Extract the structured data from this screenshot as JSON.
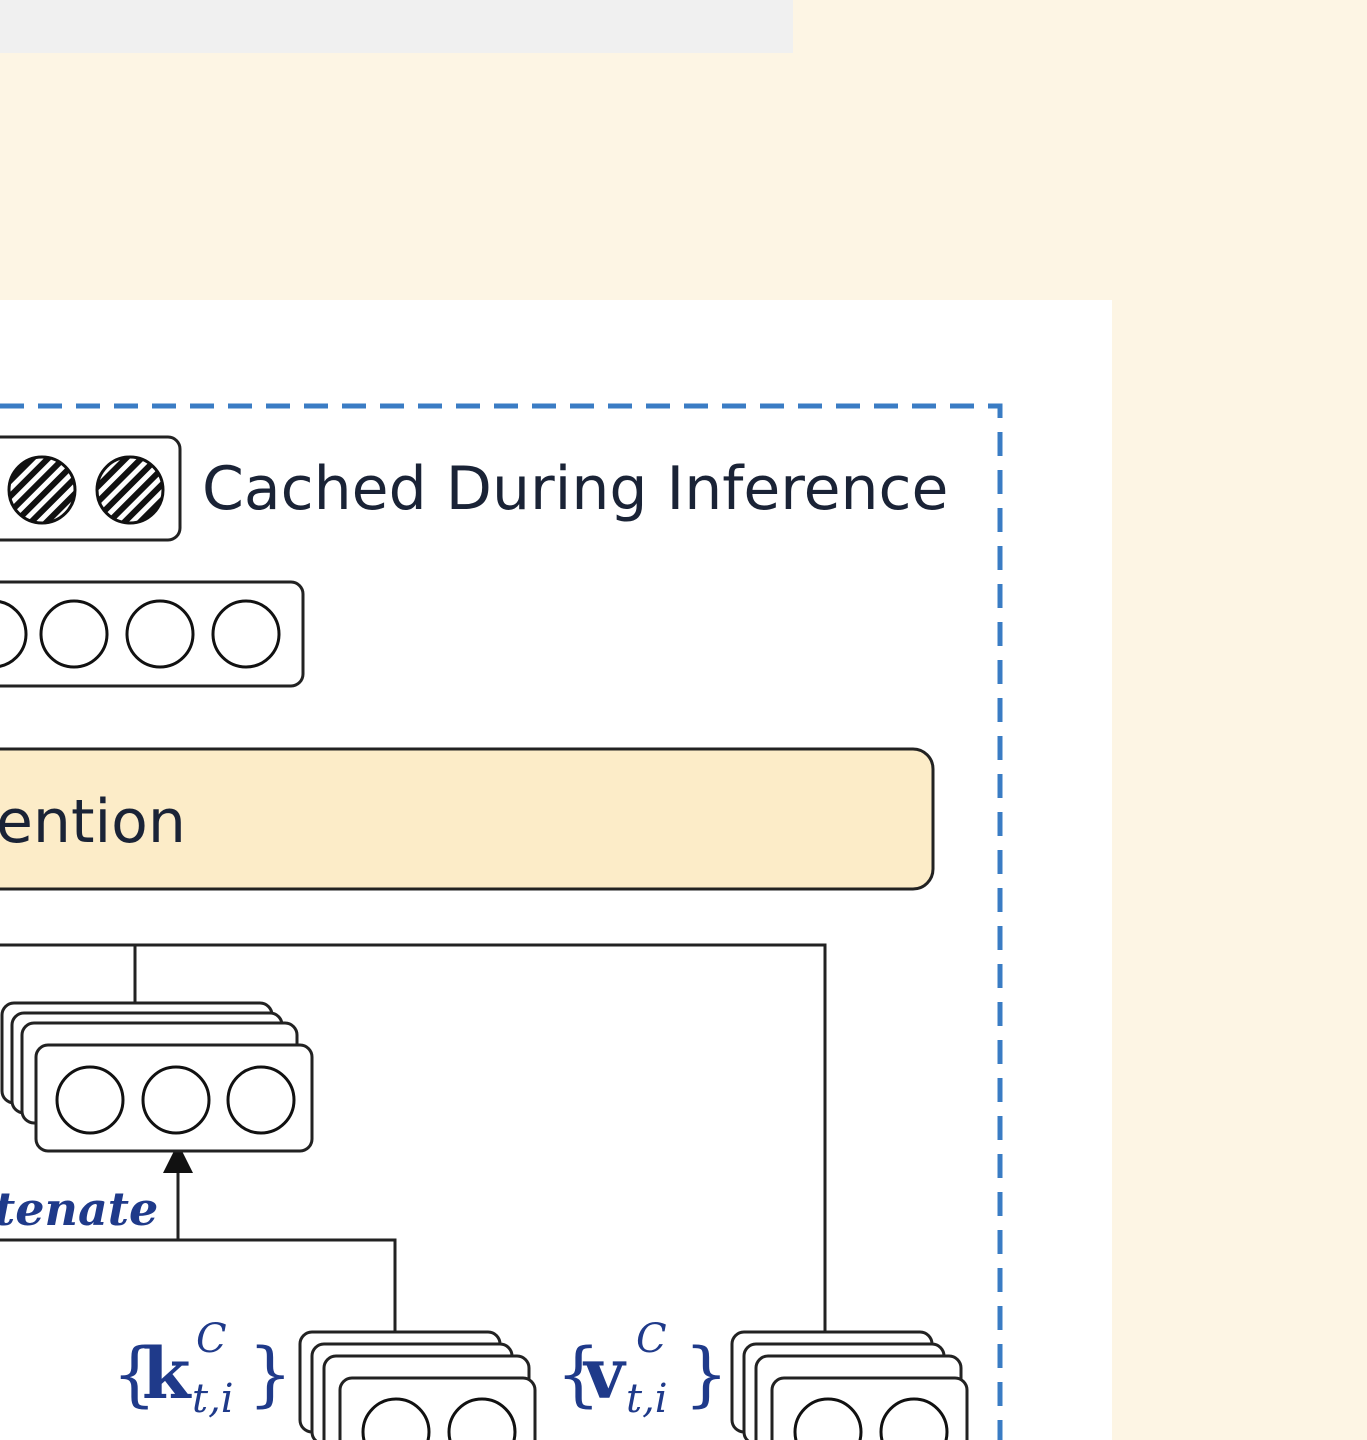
{
  "legend": {
    "cached_label": "Cached During Inference"
  },
  "attention_block": {
    "label": "ention"
  },
  "concat": {
    "label": "tenate"
  },
  "keys": {
    "brace_open": "{",
    "symbol": "k",
    "sup": "C",
    "sub": "t,i",
    "brace_close": "}"
  },
  "values": {
    "brace_open": "{",
    "symbol": "v",
    "sup": "C",
    "sub": "t,i",
    "brace_close": "}"
  },
  "colors": {
    "dashed_border": "#3a7cc4",
    "attention_fill": "#fcecc8",
    "background": "#fdf5e4",
    "panel": "#ffffff"
  }
}
